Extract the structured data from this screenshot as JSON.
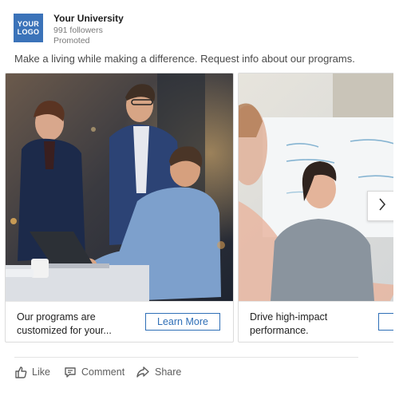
{
  "header": {
    "logo_line1": "YOUR",
    "logo_line2": "LOGO",
    "company_name": "Your University",
    "followers": "991 followers",
    "promoted": "Promoted"
  },
  "post_text": "Make a living while making a difference. Request info about our programs.",
  "carousel": {
    "cards": [
      {
        "caption_line1": "Our programs are",
        "caption_line2": "customized for your...",
        "button_label": "Learn More"
      },
      {
        "caption_line1": "Drive high-impact",
        "caption_line2": "performance.",
        "button_label": "L"
      }
    ],
    "next_icon": "chevron-right-icon"
  },
  "actions": {
    "like": "Like",
    "comment": "Comment",
    "share": "Share"
  },
  "colors": {
    "logo_bg": "#3b73b9",
    "button_blue": "#2f6fb7",
    "muted_text": "#7a7a7a"
  }
}
